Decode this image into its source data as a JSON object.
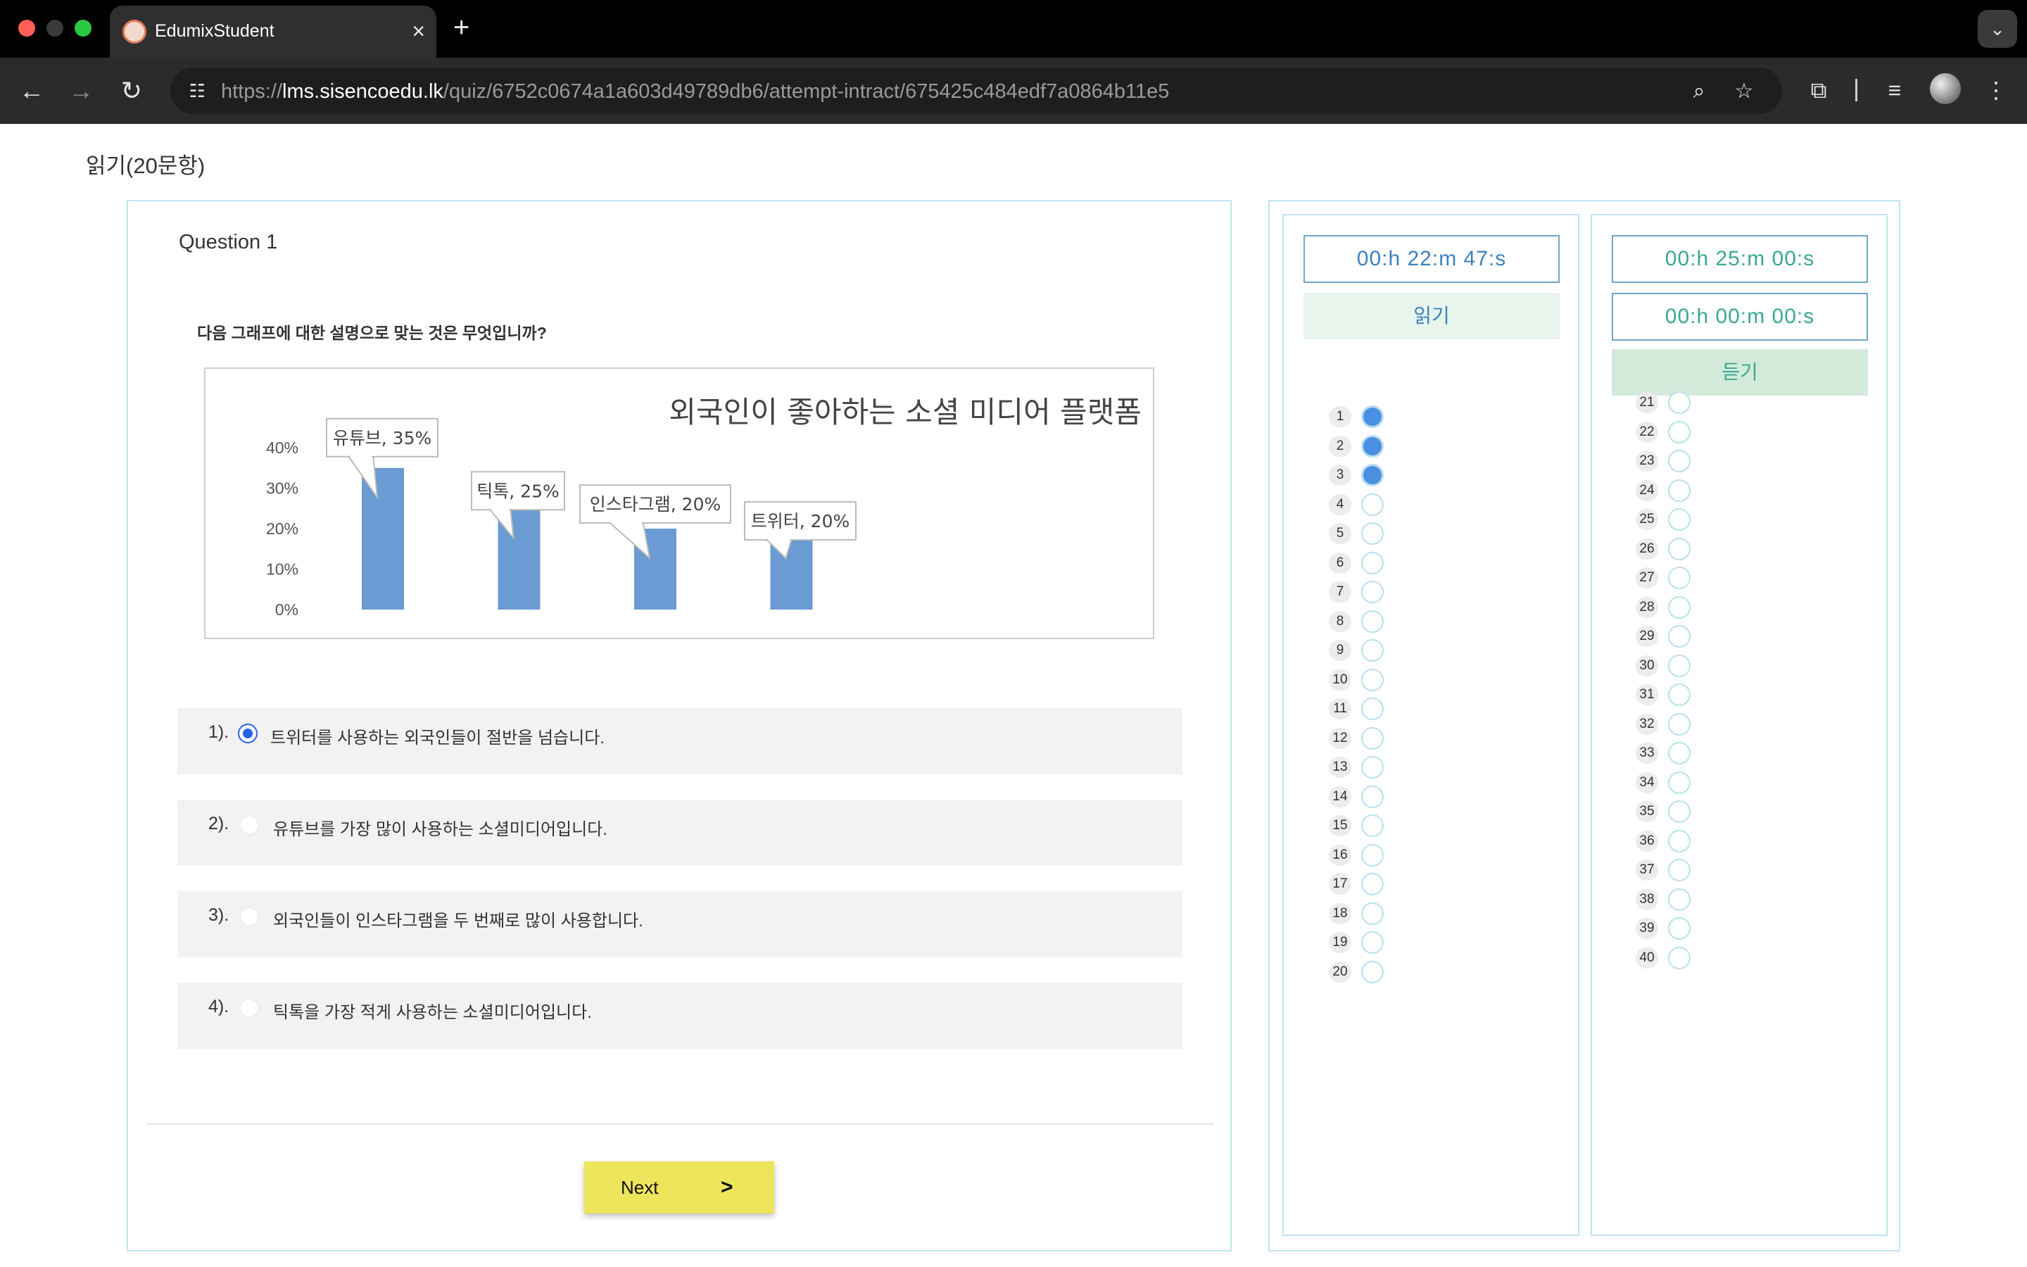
{
  "browser": {
    "tab_title": "EdumixStudent",
    "tab_close": "×",
    "new_tab": "+",
    "tab_menu": "⌄",
    "url_prefix": "https://",
    "url_host": "lms.sisencoedu.lk",
    "url_path": "/quiz/6752c0674a1a603d49789db6/attempt-intract/675425c484edf7a0864b11e5"
  },
  "page": {
    "section_title": "읽기(20문항)"
  },
  "question": {
    "label": "Question 1",
    "text": "다음 그래프에 대한 설명으로 맞는 것은 무엇입니까?",
    "options": [
      {
        "num": "1).",
        "text": "트위터를 사용하는 외국인들이 절반을 넘습니다.",
        "selected": true
      },
      {
        "num": "2).",
        "text": "유튜브를 가장 많이 사용하는 소셜미디어입니다.",
        "selected": false
      },
      {
        "num": "3).",
        "text": "외국인들이 인스타그램을 두 번째로 많이 사용합니다.",
        "selected": false
      },
      {
        "num": "4).",
        "text": "틱톡을 가장 적게 사용하는 소셜미디어입니다.",
        "selected": false
      }
    ]
  },
  "chart_data": {
    "type": "bar",
    "title": "외국인이 좋아하는 소셜 미디어 플랫폼",
    "categories": [
      "유튜브",
      "틱톡",
      "인스타그램",
      "트위터"
    ],
    "values": [
      35,
      25,
      20,
      20
    ],
    "data_labels": [
      "유튜브, 35%",
      "틱톡, 25%",
      "인스타그램, 20%",
      "트위터, 20%"
    ],
    "ytick_labels": [
      "0%",
      "10%",
      "20%",
      "30%",
      "40%"
    ],
    "yticks": [
      0,
      10,
      20,
      30,
      40
    ],
    "ylim": [
      0,
      40
    ],
    "bar_color": "#6a9bd2",
    "grid": false
  },
  "navigation": {
    "next_label": "Next",
    "next_arrow": ">"
  },
  "sidebar": {
    "reading": {
      "timer": "00:h 22:m 47:s",
      "label": "읽기",
      "questions": [
        {
          "n": "1",
          "answered": true
        },
        {
          "n": "2",
          "answered": true
        },
        {
          "n": "3",
          "answered": true
        },
        {
          "n": "4",
          "answered": false
        },
        {
          "n": "5",
          "answered": false
        },
        {
          "n": "6",
          "answered": false
        },
        {
          "n": "7",
          "answered": false
        },
        {
          "n": "8",
          "answered": false
        },
        {
          "n": "9",
          "answered": false
        },
        {
          "n": "10",
          "answered": false
        },
        {
          "n": "11",
          "answered": false
        },
        {
          "n": "12",
          "answered": false
        },
        {
          "n": "13",
          "answered": false
        },
        {
          "n": "14",
          "answered": false
        },
        {
          "n": "15",
          "answered": false
        },
        {
          "n": "16",
          "answered": false
        },
        {
          "n": "17",
          "answered": false
        },
        {
          "n": "18",
          "answered": false
        },
        {
          "n": "19",
          "answered": false
        },
        {
          "n": "20",
          "answered": false
        }
      ]
    },
    "listening": {
      "timer_total": "00:h 25:m 00:s",
      "timer_elapsed": "00:h 00:m 00:s",
      "label": "듣기",
      "questions": [
        {
          "n": "21",
          "answered": false
        },
        {
          "n": "22",
          "answered": false
        },
        {
          "n": "23",
          "answered": false
        },
        {
          "n": "24",
          "answered": false
        },
        {
          "n": "25",
          "answered": false
        },
        {
          "n": "26",
          "answered": false
        },
        {
          "n": "27",
          "answered": false
        },
        {
          "n": "28",
          "answered": false
        },
        {
          "n": "29",
          "answered": false
        },
        {
          "n": "30",
          "answered": false
        },
        {
          "n": "31",
          "answered": false
        },
        {
          "n": "32",
          "answered": false
        },
        {
          "n": "33",
          "answered": false
        },
        {
          "n": "34",
          "answered": false
        },
        {
          "n": "35",
          "answered": false
        },
        {
          "n": "36",
          "answered": false
        },
        {
          "n": "37",
          "answered": false
        },
        {
          "n": "38",
          "answered": false
        },
        {
          "n": "39",
          "answered": false
        },
        {
          "n": "40",
          "answered": false
        }
      ]
    }
  }
}
